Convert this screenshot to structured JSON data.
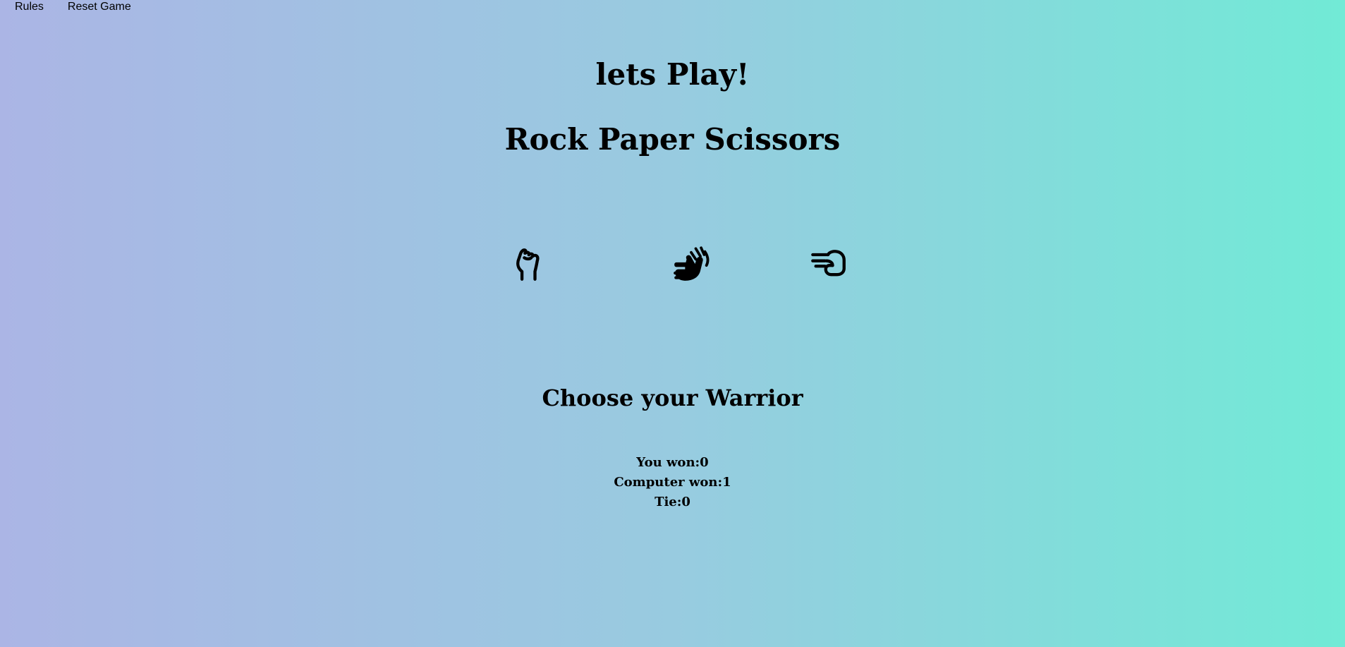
{
  "nav": {
    "rules_label": "Rules",
    "reset_label": "Reset Game"
  },
  "heading": {
    "play": "lets Play!",
    "title": "Rock Paper Scissors"
  },
  "choices": [
    {
      "name": "rock",
      "icon": "raised-fist-icon"
    },
    {
      "name": "paper",
      "icon": "open-hand-icon"
    },
    {
      "name": "scissors",
      "icon": "pointing-hand-icon"
    }
  ],
  "prompt": "Choose your Warrior",
  "scores": {
    "you": "You won:0",
    "computer": "Computer won:1",
    "tie": "Tie:0"
  },
  "colors": {
    "gradient_left": "#abb5e5",
    "gradient_right": "#71ead6",
    "text": "#000000"
  }
}
